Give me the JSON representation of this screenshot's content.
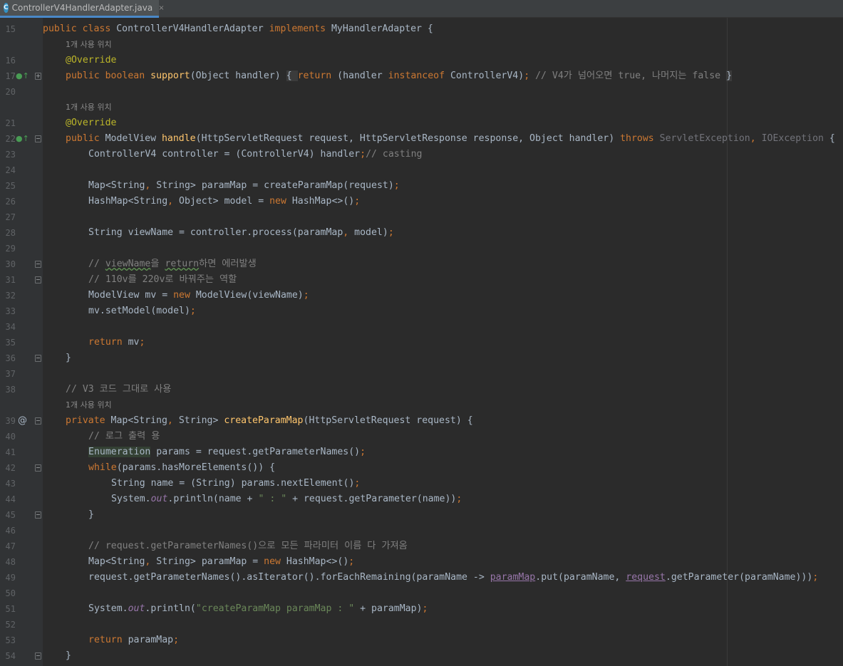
{
  "tab": {
    "icon": "C",
    "filename": "ControllerV4HandlerAdapter.java",
    "close": "×"
  },
  "hints": {
    "usage": "1개 사용 위치"
  },
  "lines": {
    "l15": {
      "num": "15"
    },
    "l16": {
      "num": "16"
    },
    "l17": {
      "num": "17"
    },
    "l20": {
      "num": "20"
    },
    "l21": {
      "num": "21"
    },
    "l22": {
      "num": "22"
    },
    "l23": {
      "num": "23"
    },
    "l24": {
      "num": "24"
    },
    "l25": {
      "num": "25"
    },
    "l26": {
      "num": "26"
    },
    "l27": {
      "num": "27"
    },
    "l28": {
      "num": "28"
    },
    "l29": {
      "num": "29"
    },
    "l30": {
      "num": "30"
    },
    "l31": {
      "num": "31"
    },
    "l32": {
      "num": "32"
    },
    "l33": {
      "num": "33"
    },
    "l34": {
      "num": "34"
    },
    "l35": {
      "num": "35"
    },
    "l36": {
      "num": "36"
    },
    "l37": {
      "num": "37"
    },
    "l38": {
      "num": "38"
    },
    "l39": {
      "num": "39"
    },
    "l40": {
      "num": "40"
    },
    "l41": {
      "num": "41"
    },
    "l42": {
      "num": "42"
    },
    "l43": {
      "num": "43"
    },
    "l44": {
      "num": "44"
    },
    "l45": {
      "num": "45"
    },
    "l46": {
      "num": "46"
    },
    "l47": {
      "num": "47"
    },
    "l48": {
      "num": "48"
    },
    "l49": {
      "num": "49"
    },
    "l50": {
      "num": "50"
    },
    "l51": {
      "num": "51"
    },
    "l52": {
      "num": "52"
    },
    "l53": {
      "num": "53"
    },
    "l54": {
      "num": "54"
    }
  },
  "tokens": {
    "public": "public",
    "class": "class",
    "className": " ControllerV4HandlerAdapter ",
    "implements": "implements",
    "iface": " MyHandlerAdapter {",
    "override": "@Override",
    "boolean": "boolean",
    "support": "support",
    "supportArgs": "(Object handler) ",
    "foldOpen": "{ ",
    "return": "return",
    "supportBody": " (handler ",
    "instanceof": "instanceof",
    "supportBody2": " ControllerV4)",
    "semi": ";",
    "supportComment": " // V4가 넘어오면 true, 나머지는 false ",
    "foldClose": "}",
    "modelView": " ModelView ",
    "handle": "handle",
    "handleArgs": "(HttpServletRequest request, HttpServletResponse response, Object handler) ",
    "throws": "throws",
    "servletException": " ServletException",
    "comma": ",",
    "ioException": " IOException",
    "brace": " {",
    "l23a": "ControllerV4 controller = (ControllerV4) handler",
    "l23c": "// casting",
    "l25a": "Map<String",
    "l25b": " String> paramMap = createParamMap(request)",
    "l26a": "HashMap<String",
    "l26b": " Object> model = ",
    "new": "new",
    "l26c": " HashMap<>()",
    "l28a": "String viewName = controller.process(paramMap",
    "l28b": " model)",
    "l30a": "// ",
    "l30b": "viewName",
    "l30c": "을 ",
    "l30d": "return",
    "l30e": "하면 에러발생",
    "l31": "// 110v를 220v로 바꿔주는 역할",
    "l32a": "ModelView mv = ",
    "l32b": " ModelView(viewName)",
    "l33": "mv.setModel(model)",
    "l35": " mv",
    "closeBrace": "}",
    "l38": "// V3 코드 그대로 사용",
    "private": "private",
    "l39a": " Map<String",
    "l39b": " String> ",
    "createParamMap": "createParamMap",
    "l39c": "(HttpServletRequest request) {",
    "l40": "// 로그 출력 용",
    "enumeration": "Enumeration",
    "l41b": " params = request.getParameterNames()",
    "while": "while",
    "l42b": "(params.hasMoreElements()) {",
    "l43": "String name = (String) params.nextElement()",
    "system": "System.",
    "out": "out",
    "l44b": ".println(name + ",
    "l44str": "\" : \"",
    "l44c": " + request.getParameter(name))",
    "l47": "// request.getParameterNames()으로 모든 파라미터 이름 다 가져옴",
    "l48a": "Map<String",
    "l48b": " String> paramMap = ",
    "l48c": " HashMap<>()",
    "l49a": "request.getParameterNames().asIterator().forEachRemaining(paramName -> ",
    "l49b": "paramMap",
    "l49c": ".put(paramName, ",
    "l49d": "request",
    "l49e": ".getParameter(paramName)))",
    "l51b": ".println(",
    "l51str": "\"createParamMap paramMap : \"",
    "l51c": " + paramMap)",
    "l53": " paramMap"
  }
}
